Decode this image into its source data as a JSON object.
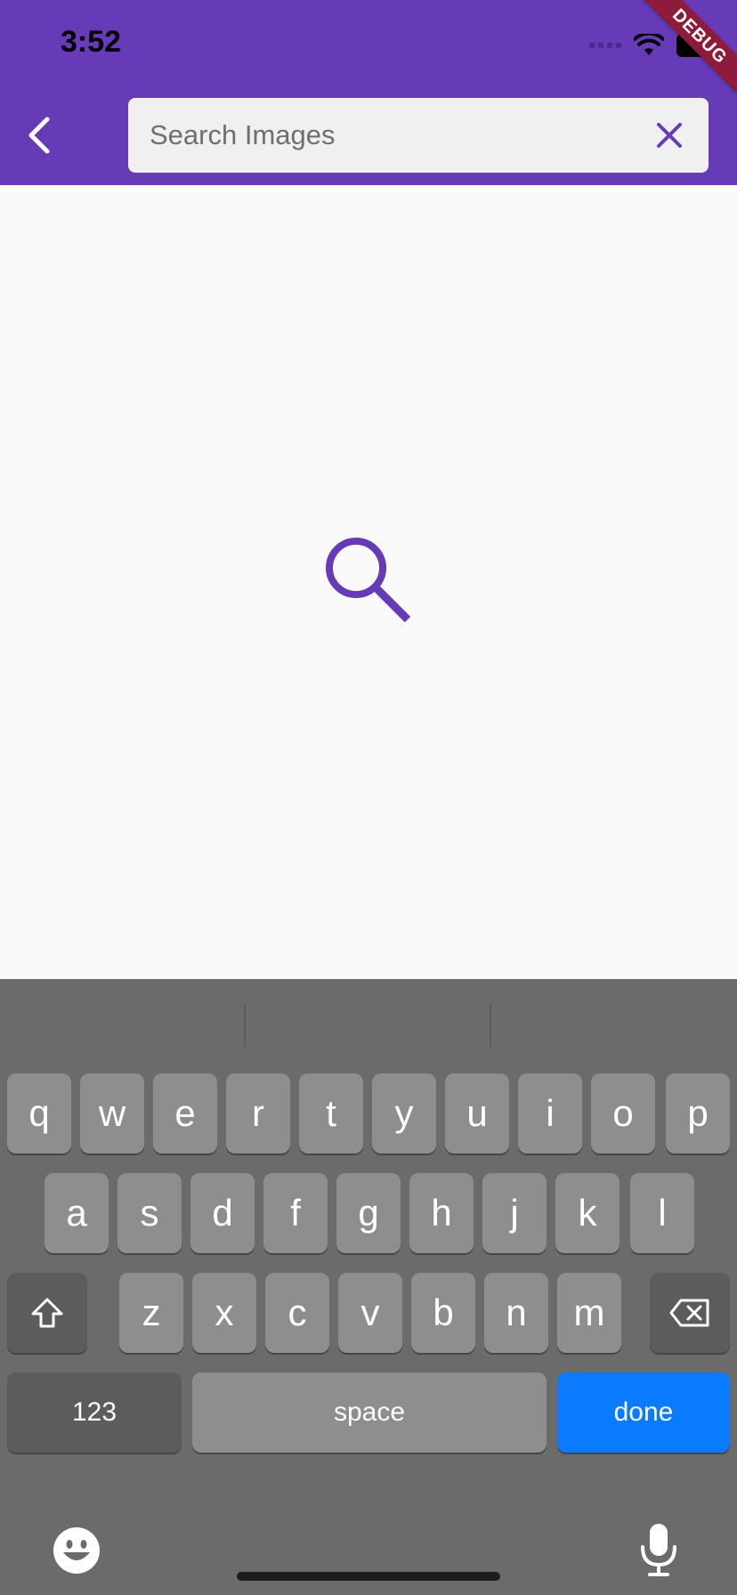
{
  "status_bar": {
    "time": "3:52"
  },
  "debug_banner": {
    "label": "DEBUG"
  },
  "app_bar": {
    "back_icon": "chevron-left-icon",
    "search": {
      "placeholder": "Search Images",
      "value": ""
    },
    "clear_icon": "close-icon"
  },
  "body": {
    "center_icon": "search-icon"
  },
  "keyboard": {
    "row1": [
      "q",
      "w",
      "e",
      "r",
      "t",
      "y",
      "u",
      "i",
      "o",
      "p"
    ],
    "row2": [
      "a",
      "s",
      "d",
      "f",
      "g",
      "h",
      "j",
      "k",
      "l"
    ],
    "row3": [
      "z",
      "x",
      "c",
      "v",
      "b",
      "n",
      "m"
    ],
    "numbers_label": "123",
    "space_label": "space",
    "done_label": "done",
    "shift_icon": "shift-icon",
    "delete_icon": "backspace-icon",
    "emoji_icon": "emoji-icon",
    "mic_icon": "microphone-icon"
  },
  "colors": {
    "primary": "#673ab7",
    "done_key": "#0a7aff",
    "keyboard_bg": "#6b6b6b"
  }
}
